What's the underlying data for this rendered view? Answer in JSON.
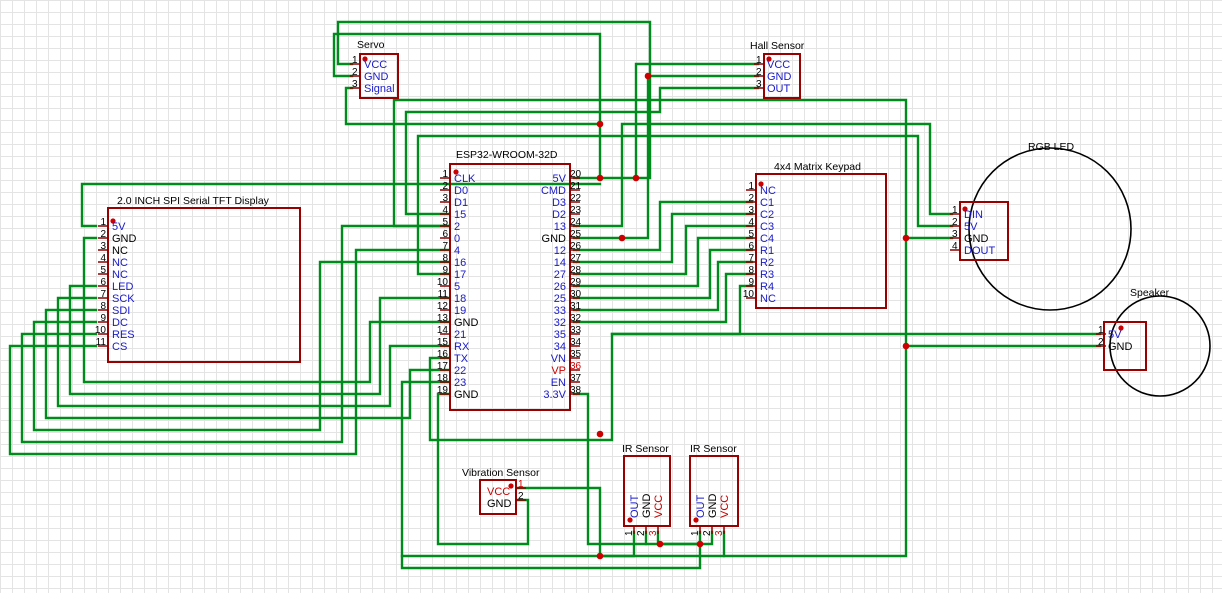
{
  "components": {
    "servo": {
      "title": "Servo",
      "pins": [
        {
          "num": "1",
          "name": "VCC"
        },
        {
          "num": "2",
          "name": "GND"
        },
        {
          "num": "3",
          "name": "Signal"
        }
      ]
    },
    "hall": {
      "title": "Hall Sensor",
      "pins": [
        {
          "num": "1",
          "name": "VCC"
        },
        {
          "num": "2",
          "name": "GND"
        },
        {
          "num": "3",
          "name": "OUT"
        }
      ]
    },
    "esp32": {
      "title": "ESP32-WROOM-32D",
      "left_pins": [
        {
          "num": "1",
          "name": "CLK"
        },
        {
          "num": "2",
          "name": "D0"
        },
        {
          "num": "3",
          "name": "D1"
        },
        {
          "num": "4",
          "name": "15"
        },
        {
          "num": "5",
          "name": "2"
        },
        {
          "num": "6",
          "name": "0"
        },
        {
          "num": "7",
          "name": "4"
        },
        {
          "num": "8",
          "name": "16"
        },
        {
          "num": "9",
          "name": "17"
        },
        {
          "num": "10",
          "name": "5"
        },
        {
          "num": "11",
          "name": "18"
        },
        {
          "num": "12",
          "name": "19"
        },
        {
          "num": "13",
          "name": "GND"
        },
        {
          "num": "14",
          "name": "21"
        },
        {
          "num": "15",
          "name": "RX"
        },
        {
          "num": "16",
          "name": "TX"
        },
        {
          "num": "17",
          "name": "22"
        },
        {
          "num": "18",
          "name": "23"
        },
        {
          "num": "19",
          "name": "GND"
        }
      ],
      "right_pins": [
        {
          "num": "20",
          "name": "5V"
        },
        {
          "num": "21",
          "name": "CMD"
        },
        {
          "num": "22",
          "name": "D3"
        },
        {
          "num": "23",
          "name": "D2"
        },
        {
          "num": "24",
          "name": "13"
        },
        {
          "num": "25",
          "name": "GND"
        },
        {
          "num": "26",
          "name": "12"
        },
        {
          "num": "27",
          "name": "14"
        },
        {
          "num": "28",
          "name": "27"
        },
        {
          "num": "29",
          "name": "26"
        },
        {
          "num": "30",
          "name": "25"
        },
        {
          "num": "31",
          "name": "33"
        },
        {
          "num": "32",
          "name": "32"
        },
        {
          "num": "33",
          "name": "35"
        },
        {
          "num": "34",
          "name": "34"
        },
        {
          "num": "35",
          "name": "VN"
        },
        {
          "num": "36",
          "name": "VP"
        },
        {
          "num": "37",
          "name": "EN"
        },
        {
          "num": "38",
          "name": "3.3V"
        }
      ]
    },
    "keypad": {
      "title": "4x4 Matrix Keypad",
      "pins": [
        {
          "num": "1",
          "name": "NC"
        },
        {
          "num": "2",
          "name": "C1"
        },
        {
          "num": "3",
          "name": "C2"
        },
        {
          "num": "4",
          "name": "C3"
        },
        {
          "num": "5",
          "name": "C4"
        },
        {
          "num": "6",
          "name": "R1"
        },
        {
          "num": "7",
          "name": "R2"
        },
        {
          "num": "8",
          "name": "R3"
        },
        {
          "num": "9",
          "name": "R4"
        },
        {
          "num": "10",
          "name": "NC"
        }
      ]
    },
    "tft": {
      "title": "2.0 INCH SPI Serial TFT Display",
      "pins": [
        {
          "num": "1",
          "name": "5V"
        },
        {
          "num": "2",
          "name": "GND"
        },
        {
          "num": "3",
          "name": "NC"
        },
        {
          "num": "4",
          "name": "NC"
        },
        {
          "num": "5",
          "name": "NC"
        },
        {
          "num": "6",
          "name": "LED"
        },
        {
          "num": "7",
          "name": "SCK"
        },
        {
          "num": "8",
          "name": "SDI"
        },
        {
          "num": "9",
          "name": "DC"
        },
        {
          "num": "10",
          "name": "RES"
        },
        {
          "num": "11",
          "name": "CS"
        }
      ]
    },
    "rgb": {
      "title": "RGB LED",
      "pins": [
        {
          "num": "1",
          "name": "DIN"
        },
        {
          "num": "2",
          "name": "5V"
        },
        {
          "num": "3",
          "name": "GND"
        },
        {
          "num": "4",
          "name": "DOUT"
        }
      ]
    },
    "speaker": {
      "title": "Speaker",
      "pins": [
        {
          "num": "1",
          "name": "5V"
        },
        {
          "num": "2",
          "name": "GND"
        }
      ]
    },
    "vibration": {
      "title": "Vibration Sensor",
      "pins": [
        {
          "num": "1",
          "name": "VCC"
        },
        {
          "num": "2",
          "name": "GND"
        }
      ]
    },
    "ir1": {
      "title": "IR Sensor",
      "pins": [
        {
          "num": "1",
          "name": "OUT"
        },
        {
          "num": "2",
          "name": "GND"
        },
        {
          "num": "3",
          "name": "VCC"
        }
      ]
    },
    "ir2": {
      "title": "IR Sensor",
      "pins": [
        {
          "num": "1",
          "name": "OUT"
        },
        {
          "num": "2",
          "name": "GND"
        },
        {
          "num": "3",
          "name": "VCC"
        }
      ]
    }
  },
  "colors": {
    "wire": "#008c1c",
    "body": "#990000",
    "pin_name": "#1a1acc",
    "pin_name_highlight": "#cc0000",
    "junction": "#cc0000"
  }
}
